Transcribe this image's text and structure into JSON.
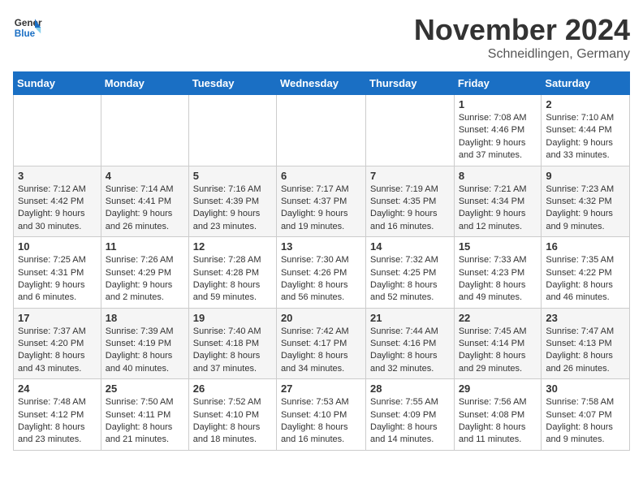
{
  "header": {
    "logo_general": "General",
    "logo_blue": "Blue",
    "title": "November 2024",
    "location": "Schneidlingen, Germany"
  },
  "weekdays": [
    "Sunday",
    "Monday",
    "Tuesday",
    "Wednesday",
    "Thursday",
    "Friday",
    "Saturday"
  ],
  "weeks": [
    [
      {
        "day": "",
        "info": ""
      },
      {
        "day": "",
        "info": ""
      },
      {
        "day": "",
        "info": ""
      },
      {
        "day": "",
        "info": ""
      },
      {
        "day": "",
        "info": ""
      },
      {
        "day": "1",
        "info": "Sunrise: 7:08 AM\nSunset: 4:46 PM\nDaylight: 9 hours and 37 minutes."
      },
      {
        "day": "2",
        "info": "Sunrise: 7:10 AM\nSunset: 4:44 PM\nDaylight: 9 hours and 33 minutes."
      }
    ],
    [
      {
        "day": "3",
        "info": "Sunrise: 7:12 AM\nSunset: 4:42 PM\nDaylight: 9 hours and 30 minutes."
      },
      {
        "day": "4",
        "info": "Sunrise: 7:14 AM\nSunset: 4:41 PM\nDaylight: 9 hours and 26 minutes."
      },
      {
        "day": "5",
        "info": "Sunrise: 7:16 AM\nSunset: 4:39 PM\nDaylight: 9 hours and 23 minutes."
      },
      {
        "day": "6",
        "info": "Sunrise: 7:17 AM\nSunset: 4:37 PM\nDaylight: 9 hours and 19 minutes."
      },
      {
        "day": "7",
        "info": "Sunrise: 7:19 AM\nSunset: 4:35 PM\nDaylight: 9 hours and 16 minutes."
      },
      {
        "day": "8",
        "info": "Sunrise: 7:21 AM\nSunset: 4:34 PM\nDaylight: 9 hours and 12 minutes."
      },
      {
        "day": "9",
        "info": "Sunrise: 7:23 AM\nSunset: 4:32 PM\nDaylight: 9 hours and 9 minutes."
      }
    ],
    [
      {
        "day": "10",
        "info": "Sunrise: 7:25 AM\nSunset: 4:31 PM\nDaylight: 9 hours and 6 minutes."
      },
      {
        "day": "11",
        "info": "Sunrise: 7:26 AM\nSunset: 4:29 PM\nDaylight: 9 hours and 2 minutes."
      },
      {
        "day": "12",
        "info": "Sunrise: 7:28 AM\nSunset: 4:28 PM\nDaylight: 8 hours and 59 minutes."
      },
      {
        "day": "13",
        "info": "Sunrise: 7:30 AM\nSunset: 4:26 PM\nDaylight: 8 hours and 56 minutes."
      },
      {
        "day": "14",
        "info": "Sunrise: 7:32 AM\nSunset: 4:25 PM\nDaylight: 8 hours and 52 minutes."
      },
      {
        "day": "15",
        "info": "Sunrise: 7:33 AM\nSunset: 4:23 PM\nDaylight: 8 hours and 49 minutes."
      },
      {
        "day": "16",
        "info": "Sunrise: 7:35 AM\nSunset: 4:22 PM\nDaylight: 8 hours and 46 minutes."
      }
    ],
    [
      {
        "day": "17",
        "info": "Sunrise: 7:37 AM\nSunset: 4:20 PM\nDaylight: 8 hours and 43 minutes."
      },
      {
        "day": "18",
        "info": "Sunrise: 7:39 AM\nSunset: 4:19 PM\nDaylight: 8 hours and 40 minutes."
      },
      {
        "day": "19",
        "info": "Sunrise: 7:40 AM\nSunset: 4:18 PM\nDaylight: 8 hours and 37 minutes."
      },
      {
        "day": "20",
        "info": "Sunrise: 7:42 AM\nSunset: 4:17 PM\nDaylight: 8 hours and 34 minutes."
      },
      {
        "day": "21",
        "info": "Sunrise: 7:44 AM\nSunset: 4:16 PM\nDaylight: 8 hours and 32 minutes."
      },
      {
        "day": "22",
        "info": "Sunrise: 7:45 AM\nSunset: 4:14 PM\nDaylight: 8 hours and 29 minutes."
      },
      {
        "day": "23",
        "info": "Sunrise: 7:47 AM\nSunset: 4:13 PM\nDaylight: 8 hours and 26 minutes."
      }
    ],
    [
      {
        "day": "24",
        "info": "Sunrise: 7:48 AM\nSunset: 4:12 PM\nDaylight: 8 hours and 23 minutes."
      },
      {
        "day": "25",
        "info": "Sunrise: 7:50 AM\nSunset: 4:11 PM\nDaylight: 8 hours and 21 minutes."
      },
      {
        "day": "26",
        "info": "Sunrise: 7:52 AM\nSunset: 4:10 PM\nDaylight: 8 hours and 18 minutes."
      },
      {
        "day": "27",
        "info": "Sunrise: 7:53 AM\nSunset: 4:10 PM\nDaylight: 8 hours and 16 minutes."
      },
      {
        "day": "28",
        "info": "Sunrise: 7:55 AM\nSunset: 4:09 PM\nDaylight: 8 hours and 14 minutes."
      },
      {
        "day": "29",
        "info": "Sunrise: 7:56 AM\nSunset: 4:08 PM\nDaylight: 8 hours and 11 minutes."
      },
      {
        "day": "30",
        "info": "Sunrise: 7:58 AM\nSunset: 4:07 PM\nDaylight: 8 hours and 9 minutes."
      }
    ]
  ]
}
